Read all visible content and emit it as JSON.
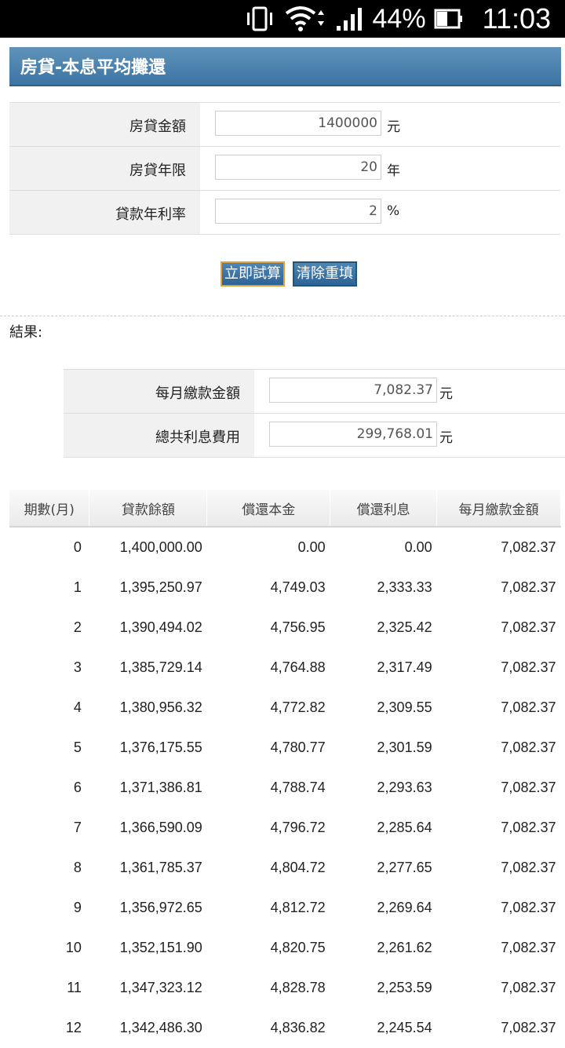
{
  "status_bar": {
    "battery": "44%",
    "time": "11:03"
  },
  "page": {
    "title": "房貸-本息平均攤還"
  },
  "form": {
    "amount_label": "房貸金額",
    "amount_value": "1400000",
    "amount_unit": "元",
    "years_label": "房貸年限",
    "years_value": "20",
    "years_unit": "年",
    "rate_label": "貸款年利率",
    "rate_value": "2",
    "rate_unit": "%"
  },
  "buttons": {
    "calculate": "立即試算",
    "reset": "清除重填"
  },
  "result": {
    "label": "結果:",
    "monthly_label": "每月繳款金額",
    "monthly_value": "7,082.37",
    "monthly_unit": "元",
    "interest_label": "總共利息費用",
    "interest_value": "299,768.01",
    "interest_unit": "元"
  },
  "schedule": {
    "headers": [
      "期數(月)",
      "貸款餘額",
      "償還本金",
      "償還利息",
      "每月繳款金額"
    ],
    "rows": [
      [
        "0",
        "1,400,000.00",
        "0.00",
        "0.00",
        "7,082.37"
      ],
      [
        "1",
        "1,395,250.97",
        "4,749.03",
        "2,333.33",
        "7,082.37"
      ],
      [
        "2",
        "1,390,494.02",
        "4,756.95",
        "2,325.42",
        "7,082.37"
      ],
      [
        "3",
        "1,385,729.14",
        "4,764.88",
        "2,317.49",
        "7,082.37"
      ],
      [
        "4",
        "1,380,956.32",
        "4,772.82",
        "2,309.55",
        "7,082.37"
      ],
      [
        "5",
        "1,376,175.55",
        "4,780.77",
        "2,301.59",
        "7,082.37"
      ],
      [
        "6",
        "1,371,386.81",
        "4,788.74",
        "2,293.63",
        "7,082.37"
      ],
      [
        "7",
        "1,366,590.09",
        "4,796.72",
        "2,285.64",
        "7,082.37"
      ],
      [
        "8",
        "1,361,785.37",
        "4,804.72",
        "2,277.65",
        "7,082.37"
      ],
      [
        "9",
        "1,356,972.65",
        "4,812.72",
        "2,269.64",
        "7,082.37"
      ],
      [
        "10",
        "1,352,151.90",
        "4,820.75",
        "2,261.62",
        "7,082.37"
      ],
      [
        "11",
        "1,347,323.12",
        "4,828.78",
        "2,253.59",
        "7,082.37"
      ],
      [
        "12",
        "1,342,486.30",
        "4,836.82",
        "2,245.54",
        "7,082.37"
      ]
    ]
  }
}
